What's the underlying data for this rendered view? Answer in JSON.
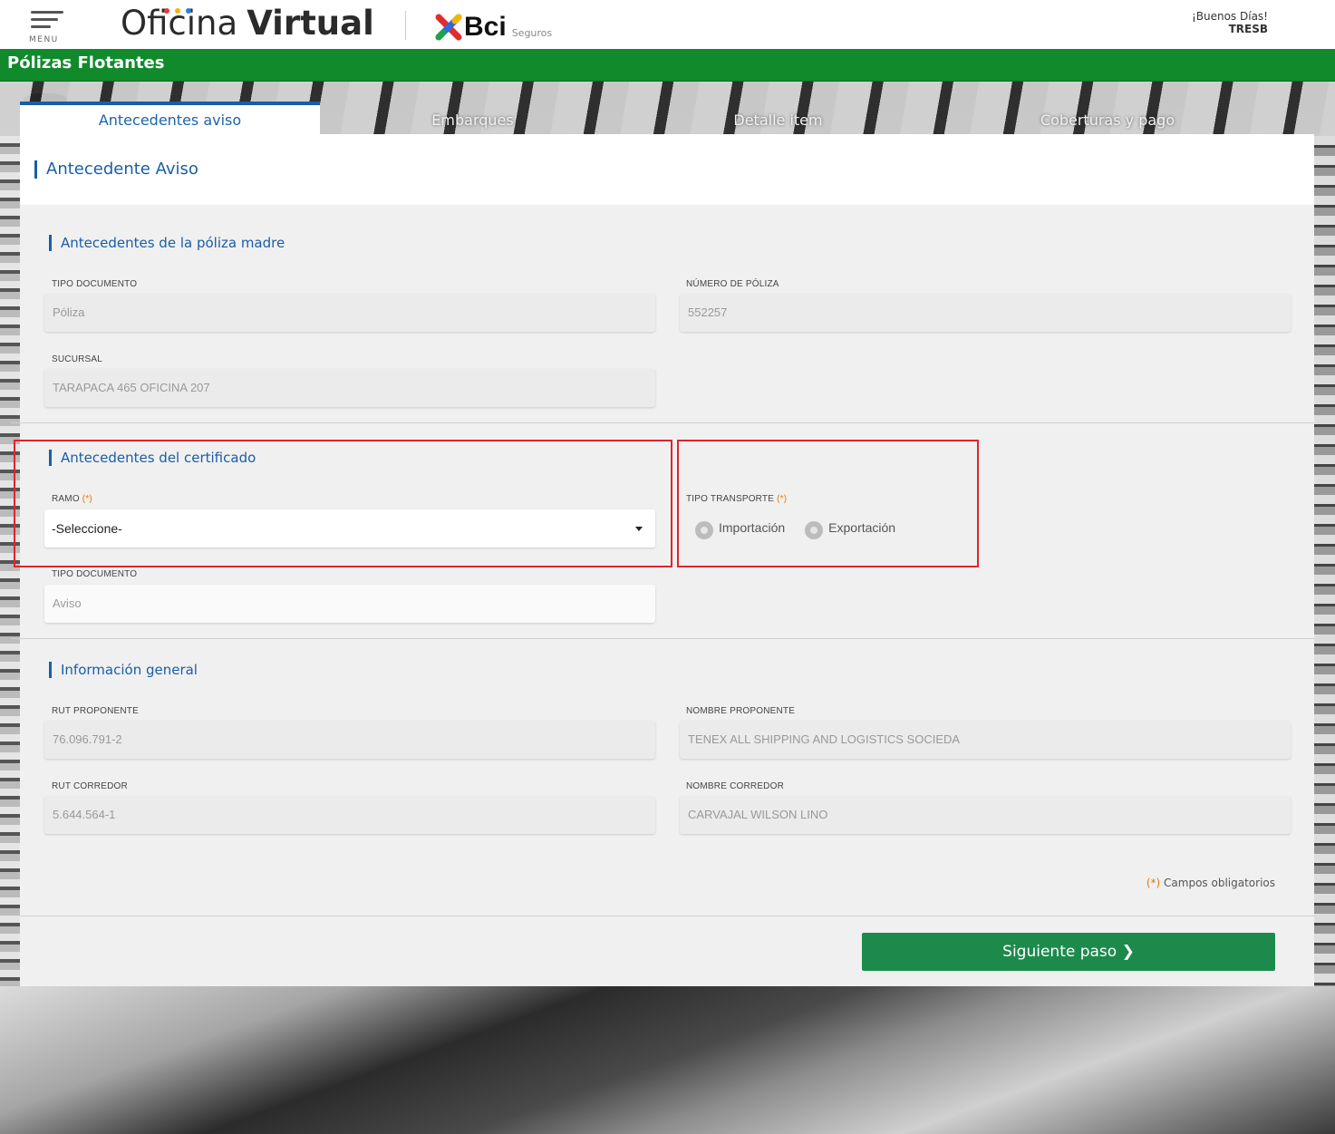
{
  "header": {
    "menu_label": "MENU",
    "brand_first": "Oficina",
    "brand_second": "Virtual",
    "logo_text": "Bci",
    "logo_subtext": "Seguros",
    "greeting": "¡Buenos Días!",
    "username": "TRESB"
  },
  "page": {
    "title": "Pólizas Flotantes"
  },
  "tabs": [
    {
      "label": "Antecedentes aviso",
      "active": true
    },
    {
      "label": "Embarques",
      "active": false
    },
    {
      "label": "Detalle item",
      "active": false
    },
    {
      "label": "Coberturas y pago",
      "active": false
    }
  ],
  "panel": {
    "title": "Antecedente Aviso",
    "poliza_madre": {
      "title": "Antecedentes de la póliza madre",
      "tipo_documento_label": "TIPO DOCUMENTO",
      "tipo_documento_value": "Póliza",
      "numero_poliza_label": "NÚMERO DE PÓLIZA",
      "numero_poliza_value": "552257",
      "sucursal_label": "SUCURSAL",
      "sucursal_value": "TARAPACA 465 OFICINA 207"
    },
    "certificado": {
      "title": "Antecedentes del certificado",
      "ramo_label": "RAMO",
      "required_mark": "(*)",
      "ramo_value": "-Seleccione-",
      "tipo_transporte_label": "TIPO TRANSPORTE",
      "transporte_options": [
        "Importación",
        "Exportación"
      ],
      "tipo_documento_label": "TIPO DOCUMENTO",
      "tipo_documento_value": "Aviso"
    },
    "general": {
      "title": "Información general",
      "rut_proponente_label": "RUT PROPONENTE",
      "rut_proponente_value": "76.096.791-2",
      "nombre_proponente_label": "NOMBRE PROPONENTE",
      "nombre_proponente_value": "TENEX ALL SHIPPING AND LOGISTICS SOCIEDA",
      "rut_corredor_label": "RUT CORREDOR",
      "rut_corredor_value": "5.644.564-1",
      "nombre_corredor_label": "NOMBRE CORREDOR",
      "nombre_corredor_value": "CARVAJAL WILSON LINO"
    },
    "obligatorios_mark": "(*)",
    "obligatorios_text": "Campos obligatorios",
    "next_button": "Siguiente paso ❯"
  },
  "colors": {
    "green_bar": "#118a2c",
    "accent_blue": "#1a5ea6",
    "button_green": "#1c8a4b",
    "highlight_red": "#e0242f",
    "required_orange": "#e07b00"
  }
}
